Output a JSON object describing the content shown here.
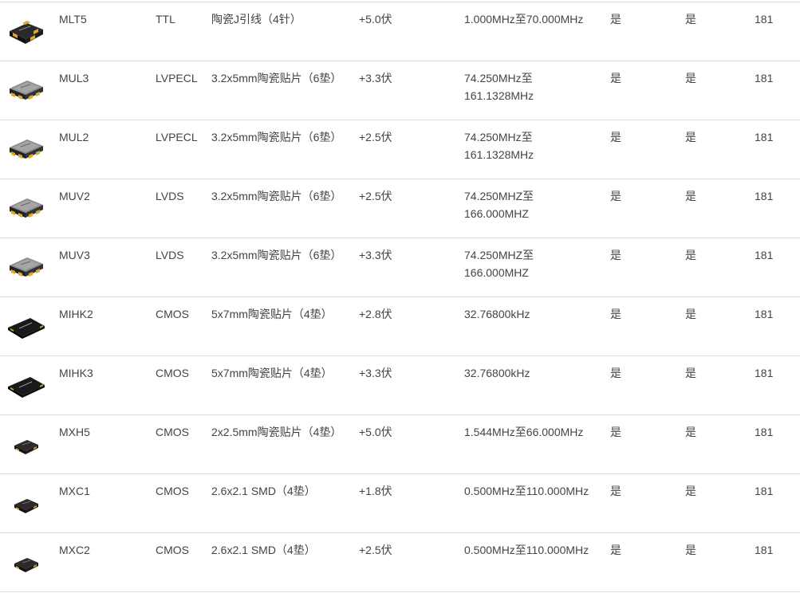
{
  "rows": [
    {
      "model": "MLT5",
      "output": "TTL",
      "package": "陶瓷J引线（4针）",
      "voltage": "+5.0伏",
      "freq": [
        "1.000MHz至70.000MHz"
      ],
      "col_a": "是",
      "col_b": "是",
      "num": "181",
      "icon": "oscillator-j-lead-icon"
    },
    {
      "model": "MUL3",
      "output": "LVPECL",
      "package": "3.2x5mm陶瓷贴片（6垫）",
      "voltage": "+3.3伏",
      "freq": [
        "74.250MHz至",
        "161.1328MHz"
      ],
      "col_a": "是",
      "col_b": "是",
      "num": "181",
      "icon": "oscillator-6pad-icon"
    },
    {
      "model": "MUL2",
      "output": "LVPECL",
      "package": "3.2x5mm陶瓷贴片（6垫）",
      "voltage": "+2.5伏",
      "freq": [
        "74.250MHz至",
        "161.1328MHz"
      ],
      "col_a": "是",
      "col_b": "是",
      "num": "181",
      "icon": "oscillator-6pad-icon"
    },
    {
      "model": "MUV2",
      "output": "LVDS",
      "package": "3.2x5mm陶瓷贴片（6垫）",
      "voltage": "+2.5伏",
      "freq": [
        "74.250MHZ至",
        "166.000MHZ"
      ],
      "col_a": "是",
      "col_b": "是",
      "num": "181",
      "icon": "oscillator-6pad-icon"
    },
    {
      "model": "MUV3",
      "output": "LVDS",
      "package": "3.2x5mm陶瓷贴片（6垫）",
      "voltage": "+3.3伏",
      "freq": [
        "74.250MHZ至",
        "166.000MHZ"
      ],
      "col_a": "是",
      "col_b": "是",
      "num": "181",
      "icon": "oscillator-6pad-icon"
    },
    {
      "model": "MIHK2",
      "output": "CMOS",
      "package": "5x7mm陶瓷贴片（4垫）",
      "voltage": "+2.8伏",
      "freq": [
        "32.76800kHz"
      ],
      "col_a": "是",
      "col_b": "是",
      "num": "181",
      "icon": "oscillator-flat-black-icon"
    },
    {
      "model": "MIHK3",
      "output": "CMOS",
      "package": "5x7mm陶瓷贴片（4垫）",
      "voltage": "+3.3伏",
      "freq": [
        "32.76800kHz"
      ],
      "col_a": "是",
      "col_b": "是",
      "num": "181",
      "icon": "oscillator-flat-black-icon"
    },
    {
      "model": "MXH5",
      "output": "CMOS",
      "package": "2x2.5mm陶瓷贴片（4垫）",
      "voltage": "+5.0伏",
      "freq": [
        "1.544MHz至66.000MHz"
      ],
      "col_a": "是",
      "col_b": "是",
      "num": "181",
      "icon": "oscillator-small-icon"
    },
    {
      "model": "MXC1",
      "output": "CMOS",
      "package": "2.6x2.1 SMD（4垫）",
      "voltage": "+1.8伏",
      "freq": [
        "0.500MHz至110.000MHz"
      ],
      "col_a": "是",
      "col_b": "是",
      "num": "181",
      "icon": "oscillator-small-icon"
    },
    {
      "model": "MXC2",
      "output": "CMOS",
      "package": "2.6x2.1 SMD（4垫）",
      "voltage": "+2.5伏",
      "freq": [
        "0.500MHz至110.000MHz"
      ],
      "col_a": "是",
      "col_b": "是",
      "num": "181",
      "icon": "oscillator-small-icon"
    }
  ]
}
